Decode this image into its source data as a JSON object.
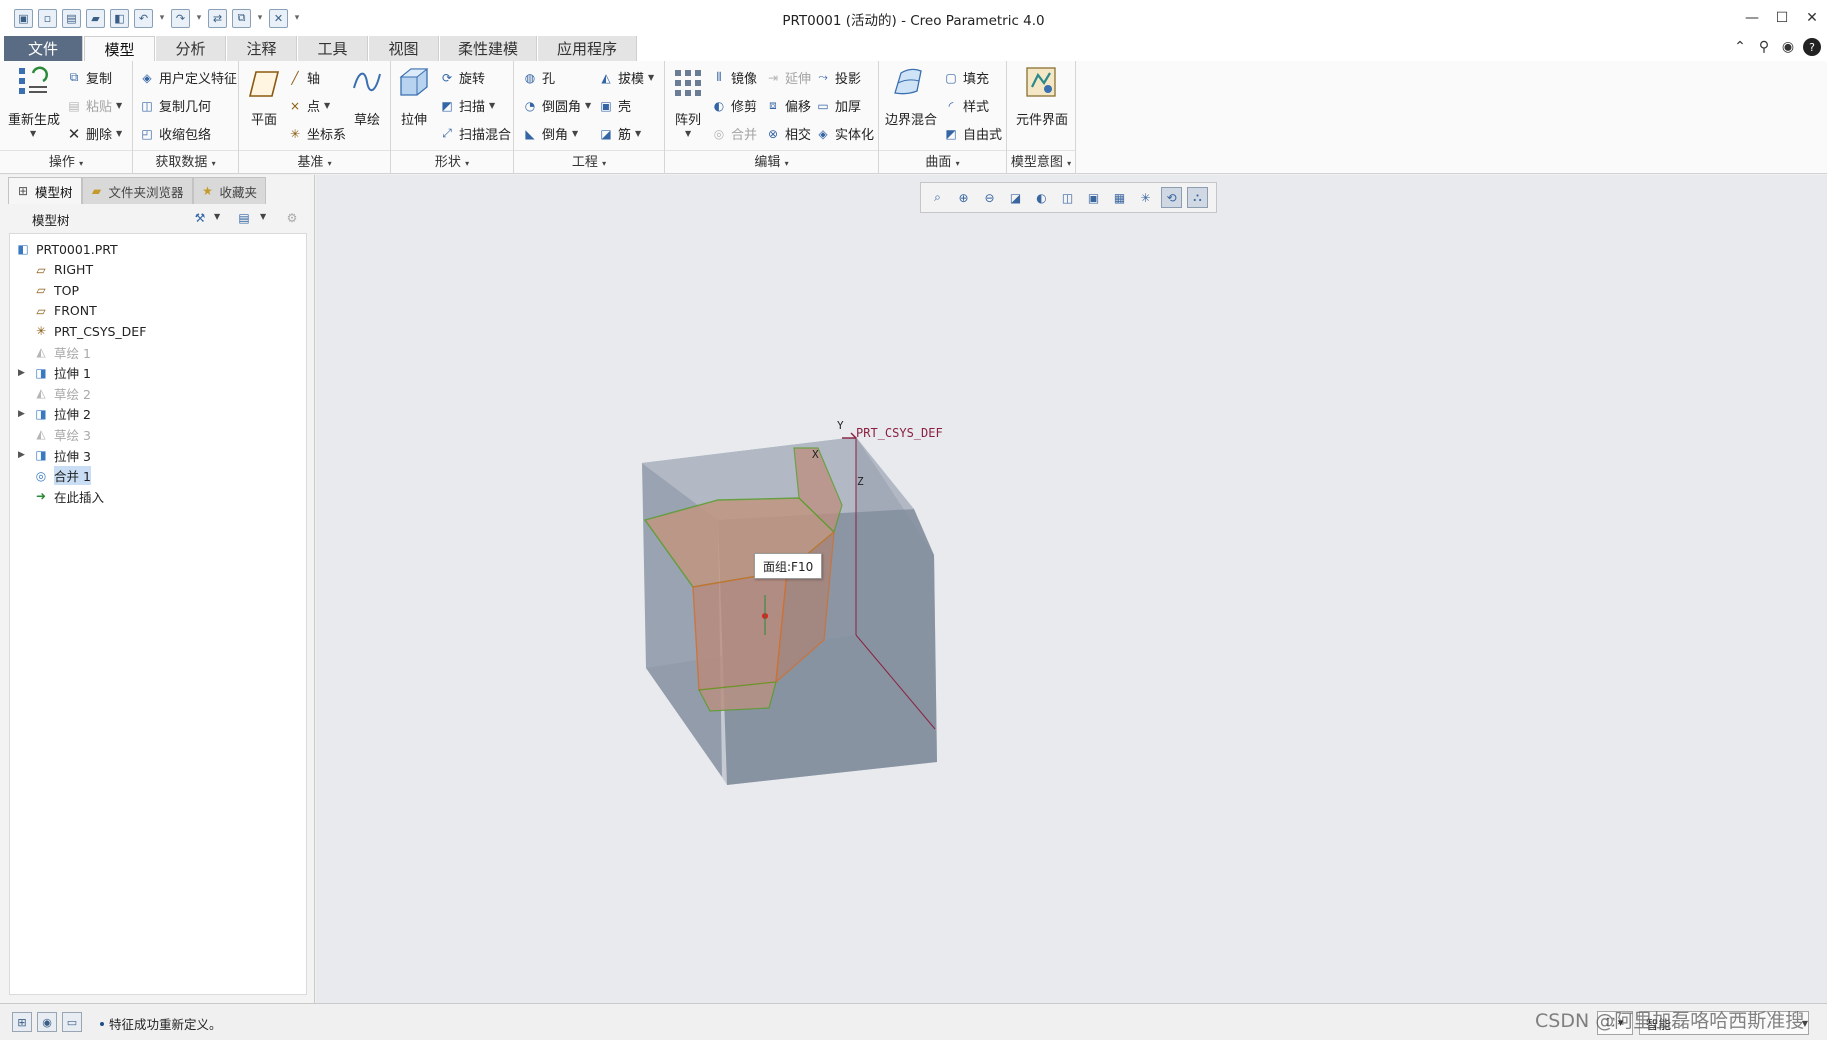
{
  "window": {
    "title": "PRT0001 (活动的) - Creo Parametric 4.0",
    "controls": [
      "—",
      "☐",
      "✕"
    ]
  },
  "quick_access": [
    "new-icon",
    "open-icon",
    "save-icon",
    "undo-icon",
    "redo-icon",
    "regenerate-icon",
    "windows-icon",
    "close-icon",
    "customize-icon"
  ],
  "tabs": [
    "文件",
    "模型",
    "分析",
    "注释",
    "工具",
    "视图",
    "柔性建模",
    "应用程序"
  ],
  "active_tab": "模型",
  "ribbon": {
    "operations": {
      "title": "操作",
      "regenerate": "重新生成",
      "copy": "复制",
      "paste": "粘贴",
      "delete": "删除"
    },
    "get_data": {
      "title": "获取数据",
      "udf": "用户定义特征",
      "copy_geometry": "复制几何",
      "shrinkwrap": "收缩包络"
    },
    "datum": {
      "title": "基准",
      "plane": "平面",
      "axis": "轴",
      "point": "点",
      "csys": "坐标系",
      "sketch": "草绘"
    },
    "shapes": {
      "title": "形状",
      "extrude": "拉伸",
      "revolve": "旋转",
      "sweep": "扫描",
      "swept_blend": "扫描混合"
    },
    "engineering": {
      "title": "工程",
      "hole": "孔",
      "round": "倒圆角",
      "chamfer": "倒角",
      "draft": "拔模",
      "shell": "壳",
      "rib": "筋"
    },
    "editing": {
      "title": "编辑",
      "pattern": "阵列",
      "mirror": "镜像",
      "trim": "修剪",
      "merge": "合并",
      "extend": "延伸",
      "offset": "偏移",
      "intersect": "相交",
      "project": "投影",
      "thicken": "加厚",
      "solidify": "实体化"
    },
    "surfaces": {
      "title": "曲面",
      "boundary_blend": "边界混合",
      "fill": "填充",
      "style": "样式",
      "freestyle": "自由式"
    },
    "model_intent": {
      "title": "模型意图",
      "component_interface": "元件界面"
    }
  },
  "navigator": {
    "tabs": [
      "模型树",
      "文件夹浏览器",
      "收藏夹"
    ],
    "tree_header": "模型树",
    "nodes": [
      {
        "label": "PRT0001.PRT",
        "icon": "part-icon",
        "dim": false,
        "expandable": false,
        "selected": false
      },
      {
        "label": "RIGHT",
        "icon": "datum-plane-icon",
        "dim": false,
        "expandable": false,
        "selected": false
      },
      {
        "label": "TOP",
        "icon": "datum-plane-icon",
        "dim": false,
        "expandable": false,
        "selected": false
      },
      {
        "label": "FRONT",
        "icon": "datum-plane-icon",
        "dim": false,
        "expandable": false,
        "selected": false
      },
      {
        "label": "PRT_CSYS_DEF",
        "icon": "csys-icon",
        "dim": false,
        "expandable": false,
        "selected": false
      },
      {
        "label": "草绘 1",
        "icon": "sketch-icon",
        "dim": true,
        "expandable": false,
        "selected": false
      },
      {
        "label": "拉伸 1",
        "icon": "extrude-icon",
        "dim": false,
        "expandable": true,
        "selected": false
      },
      {
        "label": "草绘 2",
        "icon": "sketch-icon",
        "dim": true,
        "expandable": false,
        "selected": false
      },
      {
        "label": "拉伸 2",
        "icon": "extrude-icon",
        "dim": false,
        "expandable": true,
        "selected": false
      },
      {
        "label": "草绘 3",
        "icon": "sketch-icon",
        "dim": true,
        "expandable": false,
        "selected": false
      },
      {
        "label": "拉伸 3",
        "icon": "extrude-icon",
        "dim": false,
        "expandable": true,
        "selected": false
      },
      {
        "label": "合并 1",
        "icon": "merge-icon",
        "dim": false,
        "expandable": false,
        "selected": true
      },
      {
        "label": "在此插入",
        "icon": "insert-here-icon",
        "dim": false,
        "expandable": false,
        "selected": false
      }
    ]
  },
  "viewport": {
    "csys_label": "PRT_CSYS_DEF",
    "axes": {
      "x": "X",
      "y": "Y",
      "z": "Z"
    },
    "tooltip": "面组:F10",
    "toolbar": [
      "refit-icon",
      "zoom-in-icon",
      "zoom-out-icon",
      "repaint-icon",
      "display-style-icon",
      "saved-orientations-icon",
      "view-manager-icon",
      "perspective-icon",
      "datum-display-icon",
      "spin-center-icon",
      "annotation-display-icon"
    ]
  },
  "status": {
    "message": "特征成功重新定义。",
    "filter_value": "智能"
  },
  "watermark": "CSDN @阿里加磊咯哈西斯准搜",
  "colors": {
    "file_tab": "#5a6c83",
    "ribbon_bg": "#fafafa",
    "viewport_bg": "#e8eaee",
    "body_fill": "#8e98a6",
    "quilt_fill": "#b69083",
    "edge_green": "#5a9c2a"
  }
}
